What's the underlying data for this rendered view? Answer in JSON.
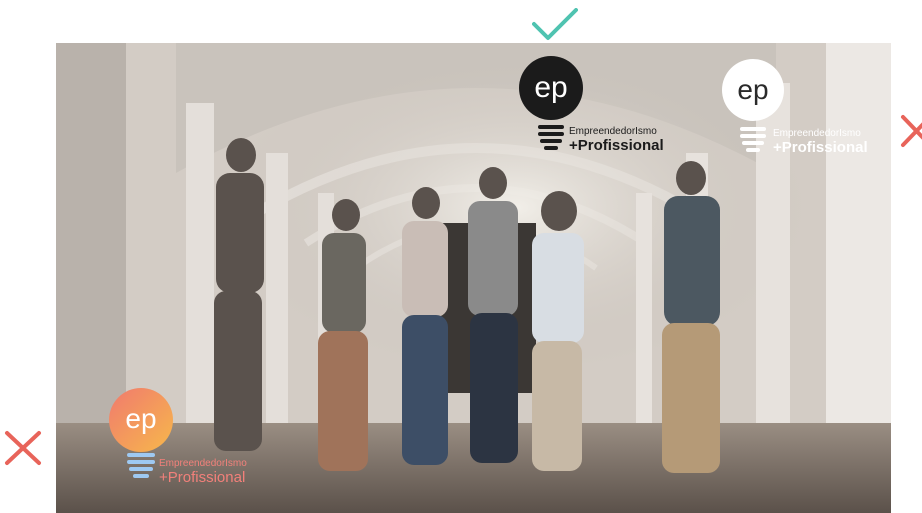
{
  "image_alt": "",
  "logo": {
    "monogram": "ep",
    "name": "EmpreendedorIsmo",
    "tagline": "+Profissional"
  },
  "variants": [
    {
      "verdict": "correct",
      "icon": "check-icon",
      "color": "#4fc3b0"
    },
    {
      "verdict": "incorrect",
      "icon": "cross-icon",
      "color": "#e8645a"
    },
    {
      "verdict": "incorrect",
      "icon": "cross-icon",
      "color": "#e8645a"
    }
  ],
  "colors": {
    "check": "#4fc3b0",
    "cross": "#e8645a",
    "logo_dark": "#1b1b1b",
    "logo_light": "#ffffff",
    "gradient_start": "#f07a6e",
    "gradient_end": "#f7b84b"
  }
}
